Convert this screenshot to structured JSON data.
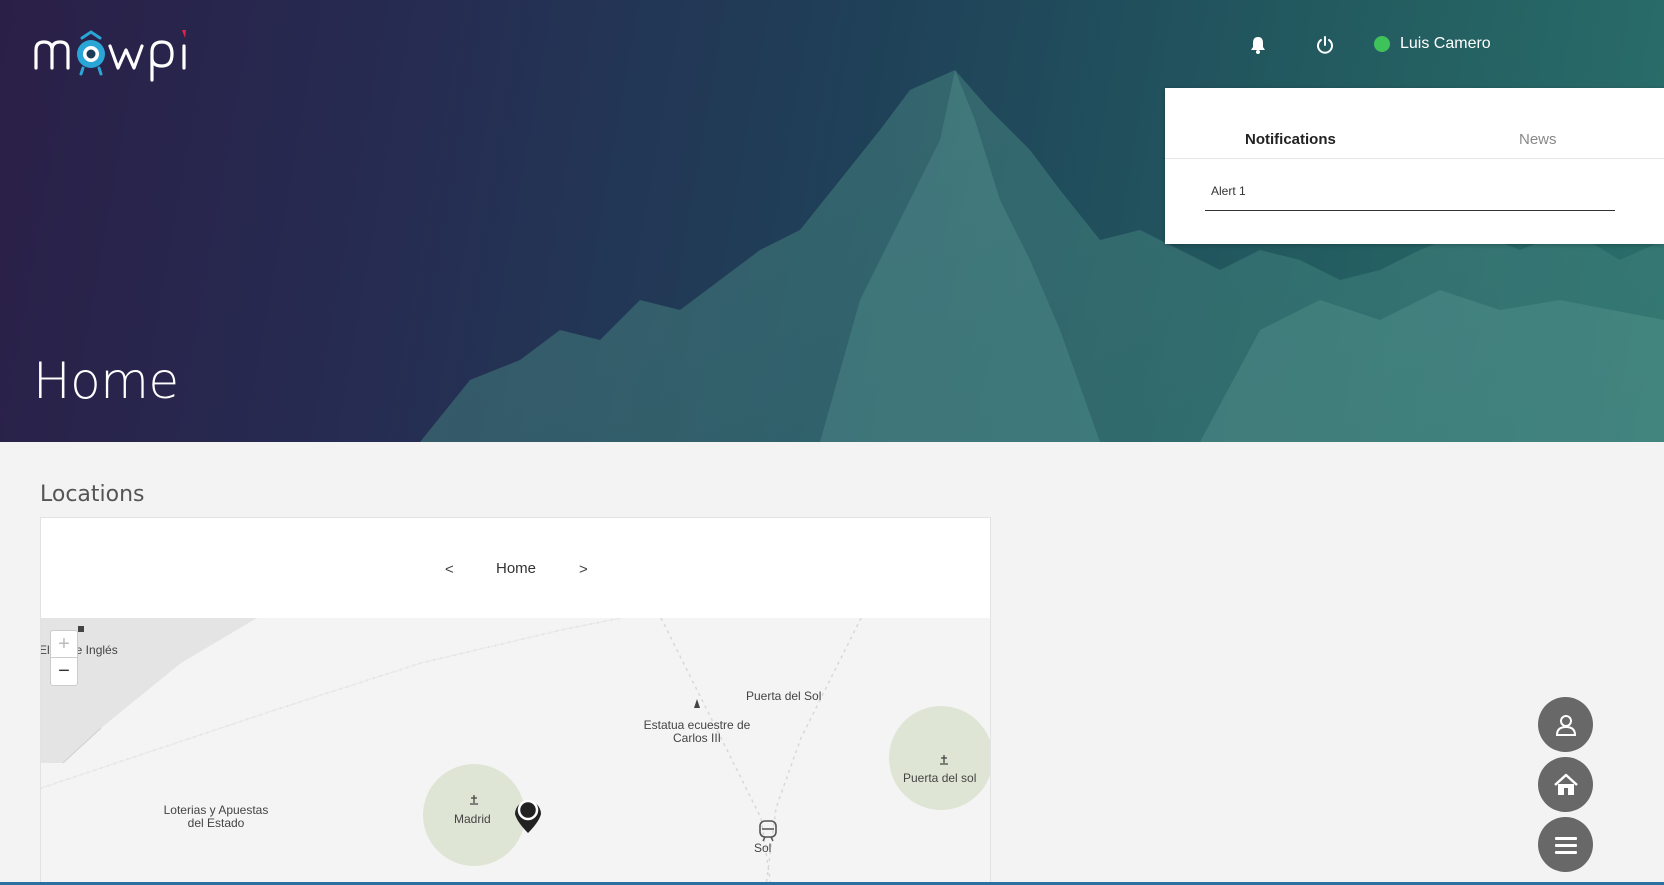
{
  "header": {
    "logo_text": "mowpi",
    "user_name": "Luis Camero",
    "user_status_color": "#3ec25a",
    "icons": [
      "bell-icon",
      "power-icon"
    ]
  },
  "hero": {
    "title": "Home"
  },
  "notifications_panel": {
    "tabs": [
      {
        "label": "Notifications",
        "active": true
      },
      {
        "label": "News",
        "active": false
      }
    ],
    "alerts": [
      "Alert 1"
    ]
  },
  "locations": {
    "section_title": "Locations",
    "nav": {
      "prev": "<",
      "current": "Home",
      "next": ">"
    },
    "map": {
      "zoom_in": "+",
      "zoom_out": "−",
      "labels": {
        "el_corte_ingles": "El Corte Inglés",
        "puerta_del_sol_street": "Puerta del Sol",
        "estatua": "Estatua ecuestre de Carlos III",
        "loterias": "Loterias y Apuestas del Estado",
        "madrid": "Madrid",
        "sol_station": "Sol",
        "puerta_del_sol_park": "Puerta del sol"
      }
    }
  },
  "fabs": [
    "user-icon",
    "home-icon",
    "menu-icon"
  ]
}
